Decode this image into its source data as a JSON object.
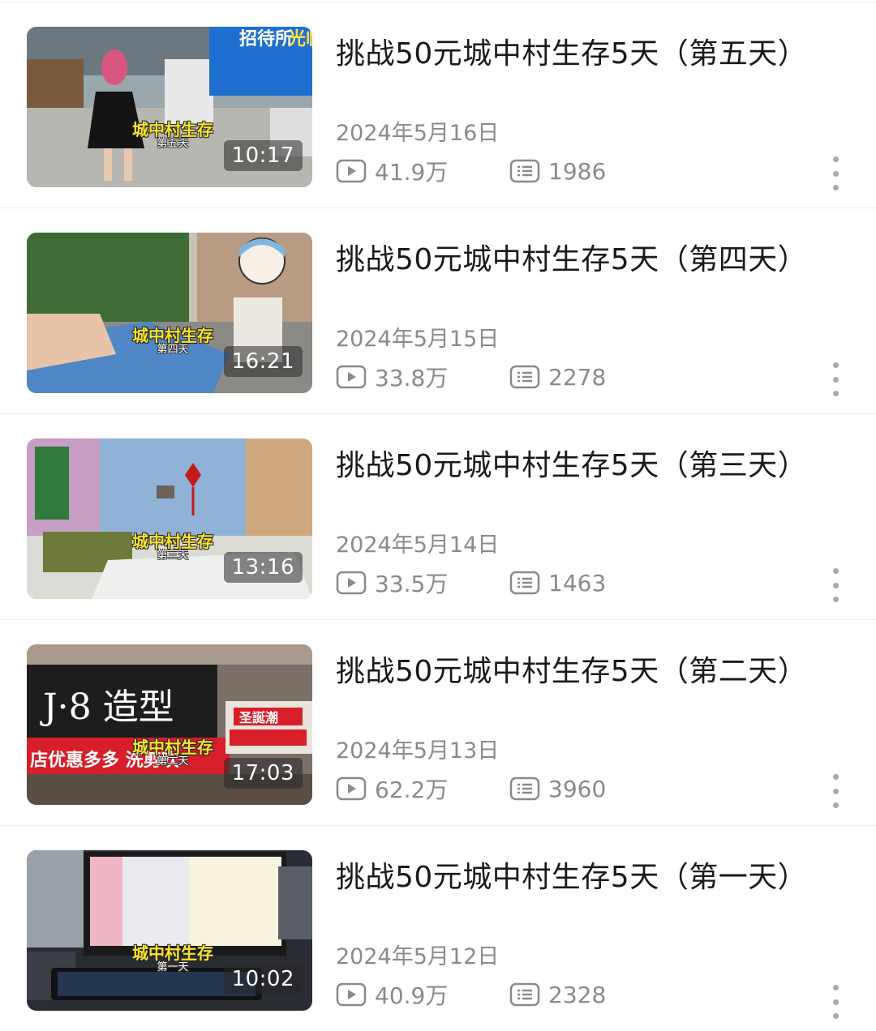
{
  "videos": [
    {
      "title": "挑战50元城中村生存5天（第五天）",
      "date": "2024年5月16日",
      "views": "41.9万",
      "danmu": "1986",
      "duration": "10:17",
      "overlay_title": "城中村生存",
      "overlay_day": "第五天"
    },
    {
      "title": "挑战50元城中村生存5天（第四天）",
      "date": "2024年5月15日",
      "views": "33.8万",
      "danmu": "2278",
      "duration": "16:21",
      "overlay_title": "城中村生存",
      "overlay_day": "第四天"
    },
    {
      "title": "挑战50元城中村生存5天（第三天）",
      "date": "2024年5月14日",
      "views": "33.5万",
      "danmu": "1463",
      "duration": "13:16",
      "overlay_title": "城中村生存",
      "overlay_day": "第三天"
    },
    {
      "title": "挑战50元城中村生存5天（第二天）",
      "date": "2024年5月13日",
      "views": "62.2万",
      "danmu": "3960",
      "duration": "17:03",
      "overlay_title": "城中村生存",
      "overlay_day": "第二天"
    },
    {
      "title": "挑战50元城中村生存5天（第一天）",
      "date": "2024年5月12日",
      "views": "40.9万",
      "danmu": "2328",
      "duration": "10:02",
      "overlay_title": "城中村生存",
      "overlay_day": "第一天"
    }
  ],
  "thumbnail_signs": {
    "v1_sign": "招待所",
    "v1_sign2": "光临",
    "v4_brand": "J·8 造型",
    "v4_banner": "店优惠多多 洗剪吹",
    "v4_side": "圣誕潮"
  },
  "icons": {
    "views": "play-icon",
    "danmu": "danmaku-icon",
    "more": "more-vertical-icon"
  },
  "colors": {
    "title": "#1a1a1a",
    "meta": "#8a8a8a",
    "overlay_yellow": "#f7e32a",
    "divider": "#ececec"
  }
}
